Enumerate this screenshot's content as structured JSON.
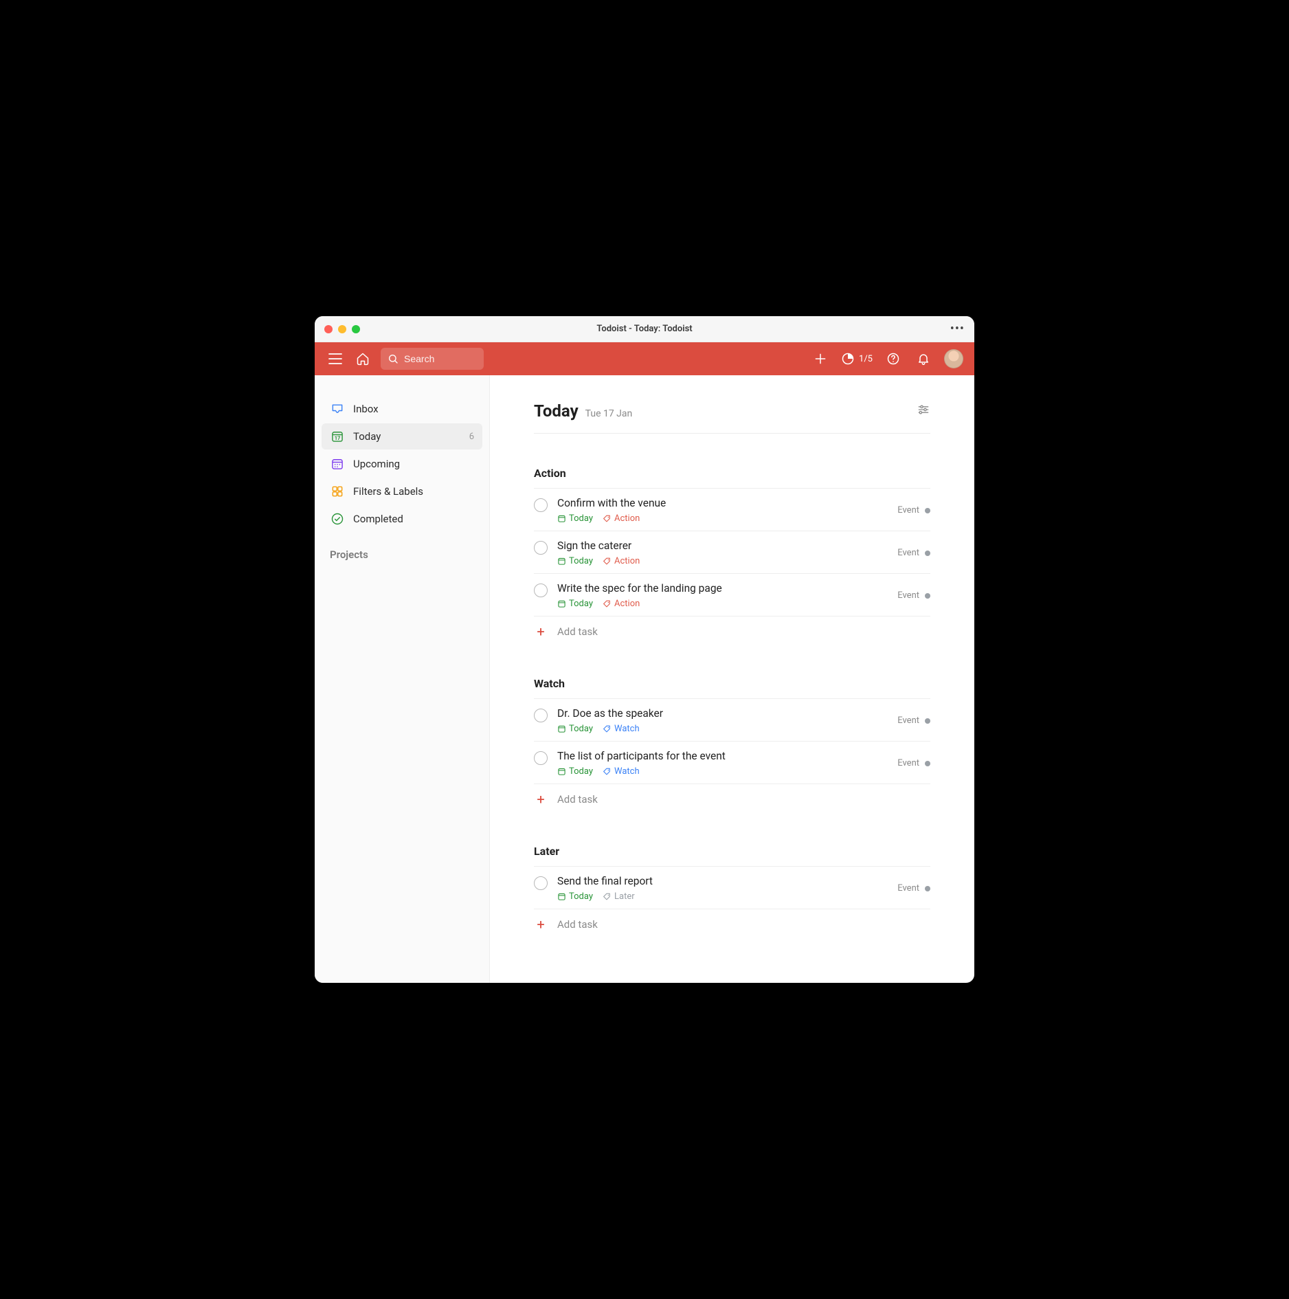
{
  "window": {
    "title": "Todoist - Today: Todoist"
  },
  "header": {
    "search_placeholder": "Search",
    "productivity": "1/5"
  },
  "sidebar": {
    "items": [
      {
        "label": "Inbox",
        "count": ""
      },
      {
        "label": "Today",
        "count": "6"
      },
      {
        "label": "Upcoming",
        "count": ""
      },
      {
        "label": "Filters & Labels",
        "count": ""
      },
      {
        "label": "Completed",
        "count": ""
      }
    ],
    "projects_header": "Projects"
  },
  "page": {
    "title": "Today",
    "subtitle": "Tue 17 Jan"
  },
  "groups": [
    {
      "title": "Action",
      "label_style": "action",
      "add_label": "Add task",
      "tasks": [
        {
          "title": "Confirm with the venue",
          "due": "Today",
          "label": "Action",
          "project": "Event"
        },
        {
          "title": "Sign the caterer",
          "due": "Today",
          "label": "Action",
          "project": "Event"
        },
        {
          "title": "Write the spec for the landing page",
          "due": "Today",
          "label": "Action",
          "project": "Event"
        }
      ]
    },
    {
      "title": "Watch",
      "label_style": "watch",
      "add_label": "Add task",
      "tasks": [
        {
          "title": "Dr. Doe as the speaker",
          "due": "Today",
          "label": "Watch",
          "project": "Event"
        },
        {
          "title": "The list of participants for the event",
          "due": "Today",
          "label": "Watch",
          "project": "Event"
        }
      ]
    },
    {
      "title": "Later",
      "label_style": "later",
      "add_label": "Add task",
      "tasks": [
        {
          "title": "Send the final report",
          "due": "Today",
          "label": "Later",
          "project": "Event"
        }
      ]
    }
  ]
}
